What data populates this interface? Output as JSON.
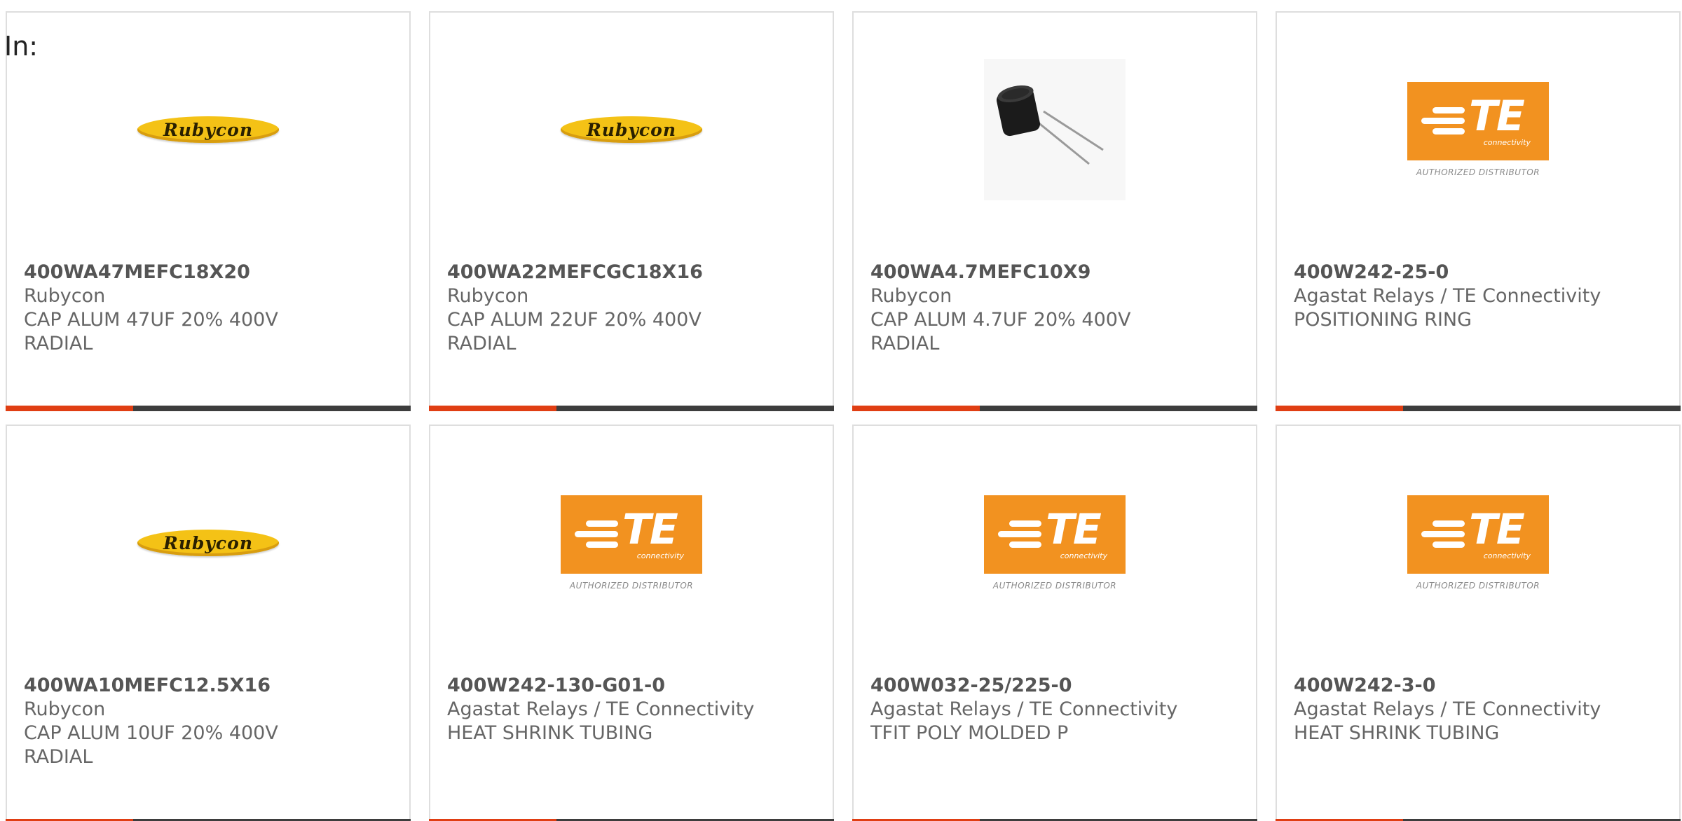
{
  "filter": {
    "label": "In:"
  },
  "colors": {
    "accent": "#e03e13",
    "bar": "#3d3d3d",
    "text": "#666666"
  },
  "products": [
    {
      "image": "rubycon-logo",
      "image_text": "Rubycon",
      "part_number": "400WA47MEFC18X20",
      "manufacturer": "Rubycon",
      "description_1": "CAP ALUM 47UF 20% 400V",
      "description_2": "RADIAL"
    },
    {
      "image": "rubycon-logo",
      "image_text": "Rubycon",
      "part_number": "400WA22MEFCGC18X16",
      "manufacturer": "Rubycon",
      "description_1": "CAP ALUM 22UF 20% 400V",
      "description_2": "RADIAL"
    },
    {
      "image": "capacitor-photo",
      "image_text": "",
      "part_number": "400WA4.7MEFC10X9",
      "manufacturer": "Rubycon",
      "description_1": "CAP ALUM 4.7UF 20% 400V",
      "description_2": "RADIAL"
    },
    {
      "image": "te-logo",
      "image_text": "TE",
      "image_subtext": "connectivity",
      "image_caption": "AUTHORIZED DISTRIBUTOR",
      "part_number": "400W242-25-0",
      "manufacturer": "Agastat Relays / TE Connectivity",
      "description_1": "POSITIONING RING",
      "description_2": ""
    },
    {
      "image": "rubycon-logo",
      "image_text": "Rubycon",
      "part_number": "400WA10MEFC12.5X16",
      "manufacturer": "Rubycon",
      "description_1": "CAP ALUM 10UF 20% 400V",
      "description_2": "RADIAL"
    },
    {
      "image": "te-logo",
      "image_text": "TE",
      "image_subtext": "connectivity",
      "image_caption": "AUTHORIZED DISTRIBUTOR",
      "part_number": "400W242-130-G01-0",
      "manufacturer": "Agastat Relays / TE Connectivity",
      "description_1": "HEAT SHRINK TUBING",
      "description_2": ""
    },
    {
      "image": "te-logo",
      "image_text": "TE",
      "image_subtext": "connectivity",
      "image_caption": "AUTHORIZED DISTRIBUTOR",
      "part_number": "400W032-25/225-0",
      "manufacturer": "Agastat Relays / TE Connectivity",
      "description_1": "TFIT POLY MOLDED P",
      "description_2": ""
    },
    {
      "image": "te-logo",
      "image_text": "TE",
      "image_subtext": "connectivity",
      "image_caption": "AUTHORIZED DISTRIBUTOR",
      "part_number": "400W242-3-0",
      "manufacturer": "Agastat Relays / TE Connectivity",
      "description_1": "HEAT SHRINK TUBING",
      "description_2": ""
    }
  ]
}
